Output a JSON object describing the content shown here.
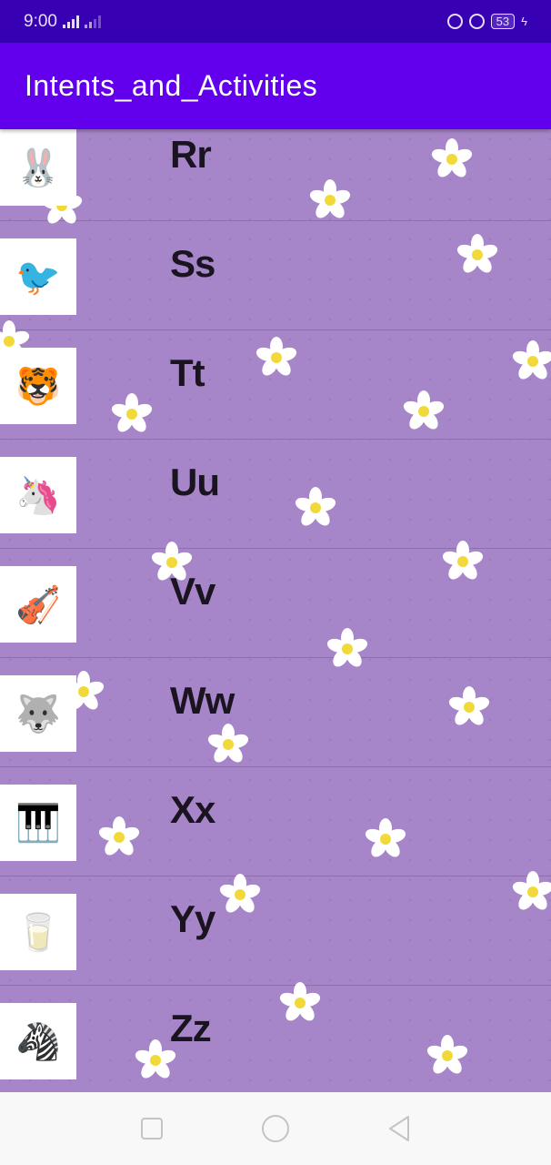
{
  "status_bar": {
    "time": "9:00",
    "battery": "53"
  },
  "app_bar": {
    "title": "Intents_and_Activities"
  },
  "items": [
    {
      "letter": "Rr",
      "image": "rabbit"
    },
    {
      "letter": "Ss",
      "image": "sparrows"
    },
    {
      "letter": "Tt",
      "image": "tiger"
    },
    {
      "letter": "Uu",
      "image": "unicorn"
    },
    {
      "letter": "Vv",
      "image": "violin"
    },
    {
      "letter": "Ww",
      "image": "wolf"
    },
    {
      "letter": "Xx",
      "image": "xylophone"
    },
    {
      "letter": "Yy",
      "image": "yogurt"
    },
    {
      "letter": "Zz",
      "image": "zebra"
    }
  ],
  "colors": {
    "status": "#3700b3",
    "appbar": "#6200ee",
    "list_bg": "#a686c9"
  }
}
